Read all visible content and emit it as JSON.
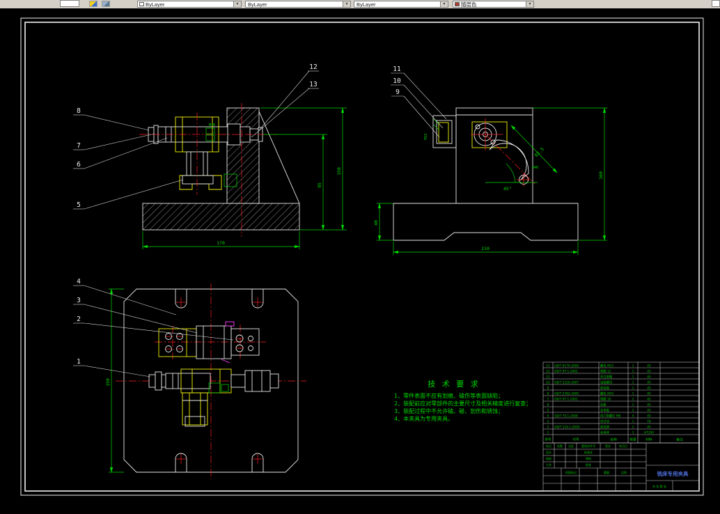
{
  "toolbar": {
    "combos": [
      {
        "label": "ByLayer"
      },
      {
        "label": "ByLayer"
      },
      {
        "label": "ByLayer"
      },
      {
        "label": "随层色"
      }
    ]
  },
  "callouts": {
    "front_left": [
      "8",
      "7",
      "6",
      "5"
    ],
    "front_top": [
      "12",
      "13"
    ],
    "side": [
      "11",
      "10",
      "9"
    ],
    "plan": [
      "4",
      "3",
      "2",
      "1"
    ]
  },
  "dims": {
    "front": {
      "height": "150",
      "inner": "95",
      "width": "170",
      "thread": "M10"
    },
    "side": {
      "height": "160",
      "base": "40",
      "width": "210",
      "angle": "45°",
      "arm": "82.5",
      "radius": "R40",
      "thread": "M12"
    },
    "plan": {
      "height": "150"
    }
  },
  "tech_req": {
    "title": "技 术 要 求",
    "lines": [
      "1、零件表面不应有划痕、磕伤等表面缺陷；",
      "2、装配前应对零部件的主要尺寸及相关精度进行复查；",
      "3、装配过程中不允许磕、碰、划伤和锈蚀；",
      "4、本夹具为专用夹具。"
    ]
  },
  "bom": {
    "header": [
      "序号",
      "代号",
      "名称",
      "数量",
      "材料",
      "备注"
    ],
    "rows": [
      {
        "no": "13",
        "code": "GB/T 6170-2000",
        "name": "螺母 M12",
        "qty": "1",
        "mat": "45"
      },
      {
        "no": "12",
        "code": "GB/T 97.1-2002",
        "name": "垫圈 12",
        "qty": "1",
        "mat": "45"
      },
      {
        "no": "11",
        "code": "",
        "name": "开口垫圈",
        "qty": "1",
        "mat": "45"
      },
      {
        "no": "10",
        "code": "GB/T 2150-2007",
        "name": "铰链螺母",
        "qty": "1",
        "mat": "45"
      },
      {
        "no": "9",
        "code": "",
        "name": "定位轴",
        "qty": "1",
        "mat": "45"
      },
      {
        "no": "8",
        "code": "GB/T 5782-2000",
        "name": "螺栓 M10",
        "qty": "1",
        "mat": "45"
      },
      {
        "no": "7",
        "code": "GB/T 97.1-2002",
        "name": "垫圈 10",
        "qty": "2",
        "mat": "45"
      },
      {
        "no": "6",
        "code": "",
        "name": "压板",
        "qty": "1",
        "mat": "45"
      },
      {
        "no": "5",
        "code": "",
        "name": "支承板",
        "qty": "1",
        "mat": "45"
      },
      {
        "no": "4",
        "code": "GB/T 70.1-2008",
        "name": "内六角螺钉 M8",
        "qty": "4",
        "mat": "45"
      },
      {
        "no": "3",
        "code": "",
        "name": "对刀块",
        "qty": "1",
        "mat": "T8"
      },
      {
        "no": "2",
        "code": "GB/T 119.1-2000",
        "name": "定位销",
        "qty": "2",
        "mat": "45"
      },
      {
        "no": "1",
        "code": "",
        "name": "夹具体",
        "qty": "1",
        "mat": "HT200"
      }
    ]
  },
  "titleblock": {
    "title": "铣床专用夹具",
    "labels": {
      "mark": "标记",
      "count": "处数",
      "zone": "分区",
      "doc": "更改文件号",
      "sign": "签名",
      "date": "年月日",
      "design": "设计",
      "standard": "标准化",
      "check": "校核",
      "review": "审核",
      "craft": "工艺",
      "approve": "批准",
      "stage": "阶段标记",
      "weight": "重量",
      "scale": "比例",
      "sheet": "共 张 第 张"
    }
  }
}
